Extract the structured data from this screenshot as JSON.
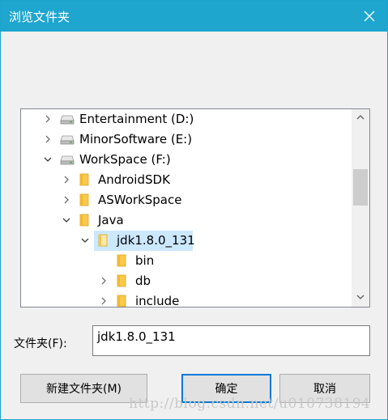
{
  "window": {
    "title": "浏览文件夹"
  },
  "tree": {
    "items": [
      {
        "label": "Entertainment (D:)",
        "icon": "drive-icon",
        "expanded": false,
        "depth": 1
      },
      {
        "label": "MinorSoftware (E:)",
        "icon": "drive-icon",
        "expanded": false,
        "depth": 1
      },
      {
        "label": "WorkSpace (F:)",
        "icon": "drive-icon",
        "expanded": true,
        "depth": 1
      },
      {
        "label": "AndroidSDK",
        "icon": "folder-icon",
        "expanded": false,
        "depth": 2
      },
      {
        "label": "ASWorkSpace",
        "icon": "folder-icon",
        "expanded": false,
        "depth": 2
      },
      {
        "label": "Java",
        "icon": "folder-icon",
        "expanded": true,
        "depth": 2
      },
      {
        "label": "jdk1.8.0_131",
        "icon": "folder-icon",
        "expanded": true,
        "depth": 3,
        "selected": true
      },
      {
        "label": "bin",
        "icon": "folder-icon",
        "expanded": null,
        "depth": 4
      },
      {
        "label": "db",
        "icon": "folder-icon",
        "expanded": false,
        "depth": 4
      },
      {
        "label": "include",
        "icon": "folder-icon",
        "expanded": false,
        "depth": 4
      }
    ]
  },
  "folder_field": {
    "label": "文件夹(F):",
    "value": "jdk1.8.0_131"
  },
  "buttons": {
    "new_folder": "新建文件夹(M)",
    "ok": "确定",
    "cancel": "取消"
  },
  "watermark": "http://blog.csdn.net/u010738194",
  "colors": {
    "titlebar": "#1ea6cf",
    "selection": "#cce8ff",
    "folder": "#f8c94a",
    "default_button_border": "#0078d7"
  }
}
